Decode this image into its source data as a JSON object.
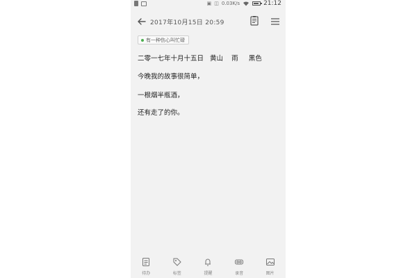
{
  "status_bar": {
    "speed": "0.03K/s",
    "time": "21:12"
  },
  "toolbar": {
    "date": "2017年10月15日  20:59"
  },
  "tag": {
    "label": "有一种伤心叫忙碌"
  },
  "note": {
    "lines": [
      "二零一七年十月十五日   黄山    雨     黑色",
      "今晚我的故事很简单，",
      "一根烟半瓶酒，",
      "还有走了的你。"
    ]
  },
  "bottom_bar": {
    "items": [
      {
        "label": "待办",
        "icon": "todo-list-icon"
      },
      {
        "label": "标签",
        "icon": "tag-icon"
      },
      {
        "label": "提醒",
        "icon": "bell-icon"
      },
      {
        "label": "录音",
        "icon": "recorder-icon"
      },
      {
        "label": "图片",
        "icon": "image-icon"
      }
    ]
  },
  "colors": {
    "background": "#f2f2f2",
    "text": "#222222",
    "tag_dot": "#4caf50"
  }
}
